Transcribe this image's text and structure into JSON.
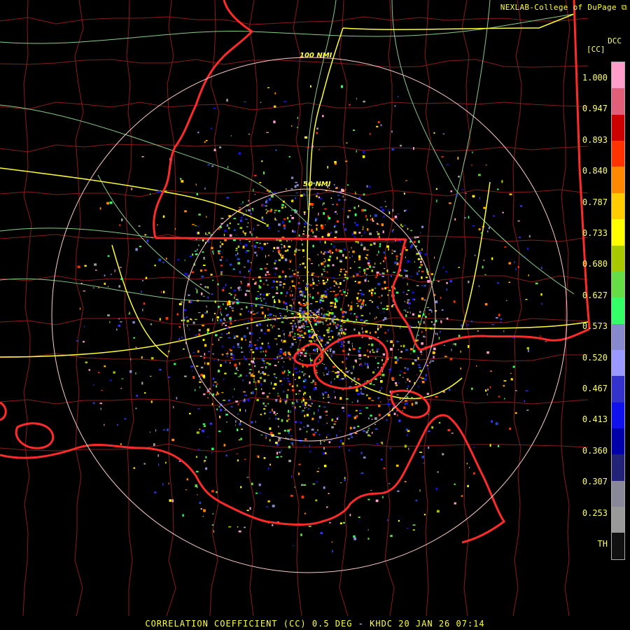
{
  "credit": "NEXLAB-College of DuPage",
  "legend": {
    "product": "DCC",
    "unit": "[CC]",
    "labels": [
      "1.000",
      "0.947",
      "0.893",
      "0.840",
      "0.787",
      "0.733",
      "0.680",
      "0.627",
      "0.573",
      "0.520",
      "0.467",
      "0.413",
      "0.360",
      "0.307",
      "0.253",
      "TH"
    ],
    "scale_colors": [
      "#ff9ec8",
      "#e0607a",
      "#cc0000",
      "#ff3300",
      "#ff8800",
      "#ffcc00",
      "#ffff00",
      "#a8c800",
      "#66dd44",
      "#33ff66",
      "#8888cc",
      "#9999ff",
      "#3333cc",
      "#1111ee",
      "#0000aa",
      "#222277",
      "#888899",
      "#999999",
      "#111111"
    ]
  },
  "range_rings": {
    "inner_label": "50 NMI",
    "outer_label": "100 NMI"
  },
  "footer": "CORRELATION COEFFICIENT (CC) 0.5 DEG - KHDC 20 JAN 26 07:14",
  "colors": {
    "county_lines": "#8b1a1a",
    "state_lines": "#ff2a2a",
    "coast": "#ff2a2a",
    "interstates": "#ffff33",
    "highways": "#88cc88",
    "range_rings": "#ffcccc"
  }
}
